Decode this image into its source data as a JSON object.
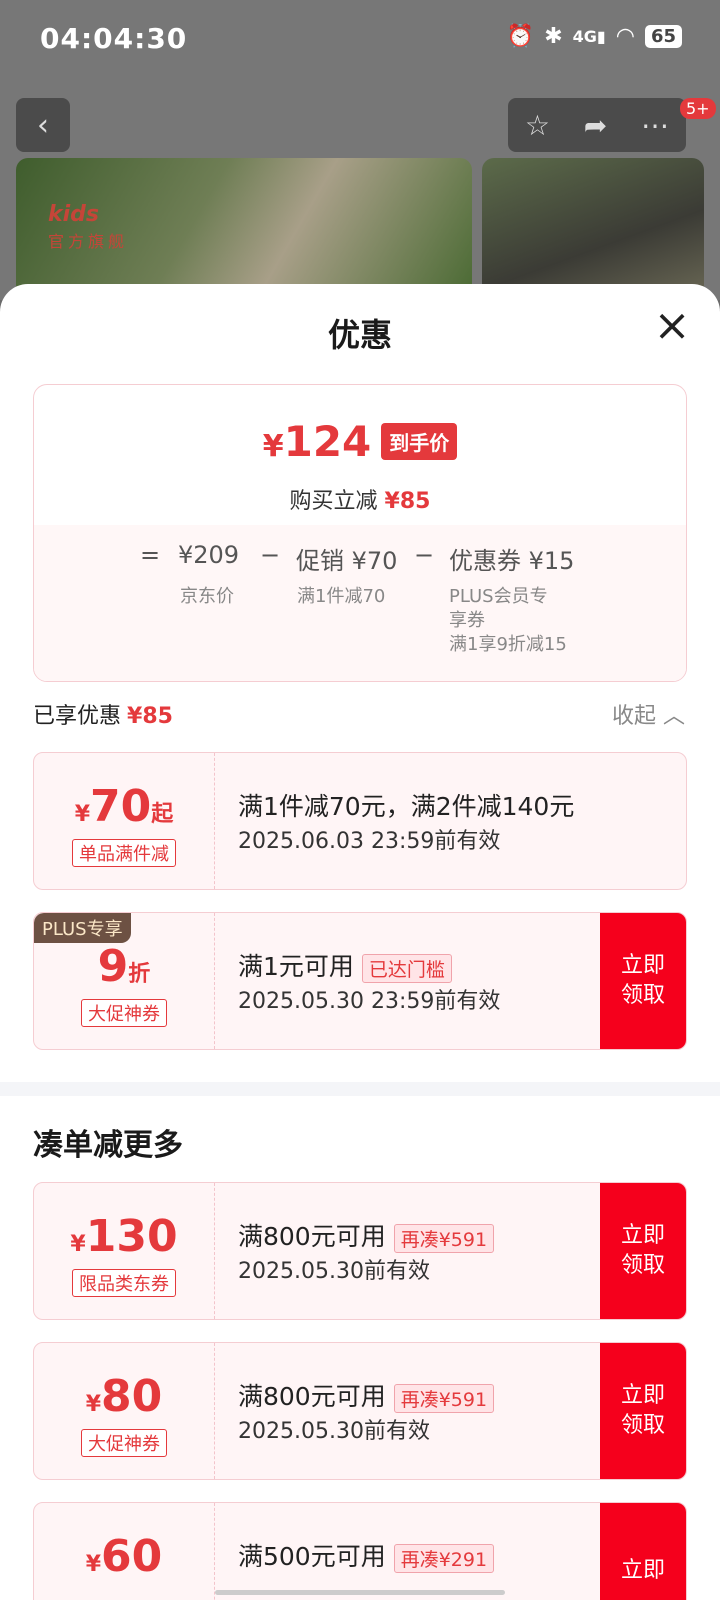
{
  "status_bar": {
    "time": "04:04:30",
    "network": "4G",
    "battery": "65",
    "icons": [
      "alarm-icon",
      "bluetooth-icon",
      "signal-icon",
      "wifi-icon",
      "battery-icon"
    ]
  },
  "product_page": {
    "message_badge": "5+",
    "brand_logo": "kids",
    "brand_subtitle": "官方旗舰"
  },
  "sheet": {
    "title": "优惠",
    "close_icon": "close-icon"
  },
  "summary": {
    "yen": "¥",
    "final_price": "124",
    "final_price_tag": "到手价",
    "save_label": "购买立减",
    "save_amount": "¥85",
    "eq": "=",
    "jd_price": "¥209",
    "jd_price_label": "京东价",
    "minus": "−",
    "promo": "促销 ¥70",
    "promo_desc": "满1件减70",
    "coupon": "优惠券 ¥15",
    "coupon_desc_1": "PLUS会员专",
    "coupon_desc_2": "享券",
    "coupon_desc_3": "满1享9折减15"
  },
  "enjoyed": {
    "label": "已享优惠",
    "amount": "¥85",
    "collapse_label": "收起"
  },
  "applied_offers": [
    {
      "symbol": "¥",
      "amount": "70",
      "unit": "起",
      "type": "单品满件减",
      "main": "满1件减70元，满2件减140元",
      "validity": "2025.06.03 23:59前有效"
    },
    {
      "plus_tag": "PLUS专享",
      "amount": "9",
      "unit": "折",
      "type": "大促神券",
      "main": "满1元可用",
      "note": "已达门槛",
      "validity": "2025.05.30 23:59前有效",
      "button": [
        "立即",
        "领取"
      ]
    }
  ],
  "more": {
    "title": "凑单减更多",
    "coupons": [
      {
        "symbol": "¥",
        "amount": "130",
        "type": "限品类东券",
        "main": "满800元可用",
        "note": "再凑¥591",
        "validity": "2025.05.30前有效",
        "button": [
          "立即",
          "领取"
        ]
      },
      {
        "symbol": "¥",
        "amount": "80",
        "type": "大促神券",
        "main": "满800元可用",
        "note": "再凑¥591",
        "validity": "2025.05.30前有效",
        "button": [
          "立即",
          "领取"
        ]
      },
      {
        "symbol": "¥",
        "amount": "60",
        "main": "满500元可用",
        "note": "再凑¥291",
        "button": [
          "立即"
        ]
      }
    ]
  },
  "colors": {
    "accent_red": "#e4393c",
    "button_red": "#f5001c",
    "plus_tag_bg": "#6d5143"
  }
}
